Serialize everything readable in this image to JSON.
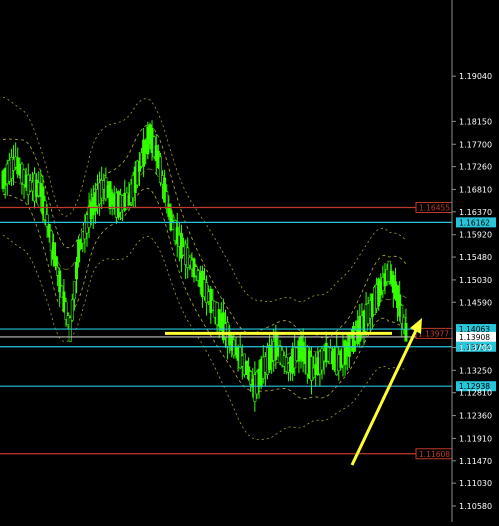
{
  "chart_data": {
    "type": "candlestick",
    "background_color": "#000000",
    "grid": false,
    "price_axis": {
      "side": "right",
      "range": [
        1.1058,
        1.205
      ],
      "ticks": [
        "1.19040",
        "1.18150",
        "1.17700",
        "1.17260",
        "1.16810",
        "1.16370",
        "1.15920",
        "1.15480",
        "1.15030",
        "1.14590",
        "1.13700",
        "1.13250",
        "1.12810",
        "1.12360",
        "1.11910",
        "1.11470",
        "1.11030",
        "1.10580"
      ],
      "tick_color": "#ffffff",
      "line_color": "#8c8c8c"
    },
    "horizontal_levels": [
      {
        "price": 1.16455,
        "label": "1.16455",
        "color": "#c0392b",
        "style": "box"
      },
      {
        "price": 1.16162,
        "label": "1.16162",
        "color": "#26c6da",
        "style": "filled"
      },
      {
        "price": 1.14063,
        "label": "1.14063",
        "color": "#26c6da",
        "style": "filled"
      },
      {
        "price": 1.13908,
        "label": "1.13908",
        "color": "#bfbfbf",
        "style": "white"
      },
      {
        "price": 1.13714,
        "label": "1.13714",
        "color": "#26c6da",
        "style": "filled"
      },
      {
        "price": 1.12938,
        "label": "1.12938",
        "color": "#26c6da",
        "style": "filled"
      },
      {
        "price": 1.11608,
        "label": "1.11608",
        "color": "#c0392b",
        "style": "box"
      }
    ],
    "current_price": {
      "label": "1.13977",
      "color": "#c0392b",
      "price": 1.13977
    },
    "candle_color": "#33ff00",
    "envelope_color": "#c8c84a",
    "highlight_color": "#ffff33",
    "price_points": [
      {
        "i": 0,
        "p": 1.17
      },
      {
        "i": 6,
        "p": 1.1735
      },
      {
        "i": 12,
        "p": 1.169
      },
      {
        "i": 18,
        "p": 1.168
      },
      {
        "i": 24,
        "p": 1.156
      },
      {
        "i": 28,
        "p": 1.148
      },
      {
        "i": 32,
        "p": 1.1405
      },
      {
        "i": 36,
        "p": 1.156
      },
      {
        "i": 42,
        "p": 1.164
      },
      {
        "i": 48,
        "p": 1.169
      },
      {
        "i": 54,
        "p": 1.165
      },
      {
        "i": 60,
        "p": 1.166
      },
      {
        "i": 66,
        "p": 1.174
      },
      {
        "i": 70,
        "p": 1.179
      },
      {
        "i": 74,
        "p": 1.174
      },
      {
        "i": 80,
        "p": 1.162
      },
      {
        "i": 86,
        "p": 1.156
      },
      {
        "i": 92,
        "p": 1.152
      },
      {
        "i": 98,
        "p": 1.147
      },
      {
        "i": 104,
        "p": 1.142
      },
      {
        "i": 110,
        "p": 1.137
      },
      {
        "i": 116,
        "p": 1.133
      },
      {
        "i": 120,
        "p": 1.129
      },
      {
        "i": 124,
        "p": 1.133
      },
      {
        "i": 130,
        "p": 1.137
      },
      {
        "i": 136,
        "p": 1.133
      },
      {
        "i": 142,
        "p": 1.137
      },
      {
        "i": 148,
        "p": 1.132
      },
      {
        "i": 154,
        "p": 1.136
      },
      {
        "i": 160,
        "p": 1.134
      },
      {
        "i": 166,
        "p": 1.138
      },
      {
        "i": 172,
        "p": 1.142
      },
      {
        "i": 178,
        "p": 1.147
      },
      {
        "i": 184,
        "p": 1.152
      },
      {
        "i": 188,
        "p": 1.147
      },
      {
        "i": 192,
        "p": 1.14
      }
    ]
  }
}
